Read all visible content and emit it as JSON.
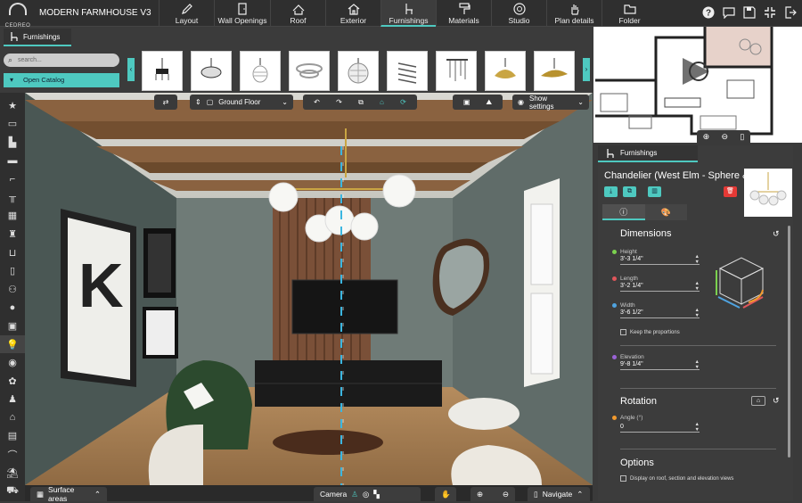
{
  "app": {
    "logo_text": "CEDREO",
    "project_title": "MODERN FARMHOUSE V3"
  },
  "nav": {
    "tabs": [
      {
        "label": "Layout",
        "icon": "pencil-icon"
      },
      {
        "label": "Wall Openings",
        "icon": "door-icon"
      },
      {
        "label": "Roof",
        "icon": "roof-icon"
      },
      {
        "label": "Exterior",
        "icon": "house-icon"
      },
      {
        "label": "Furnishings",
        "icon": "chair-icon",
        "active": true
      },
      {
        "label": "Materials",
        "icon": "paint-roller-icon"
      },
      {
        "label": "Studio",
        "icon": "aperture-icon"
      },
      {
        "label": "Plan details",
        "icon": "hand-icon"
      },
      {
        "label": "Folder",
        "icon": "folder-icon"
      }
    ]
  },
  "top_actions": [
    "help-icon",
    "comment-icon",
    "save-icon",
    "fullscreen-icon",
    "logout-icon"
  ],
  "catalog": {
    "tab_label": "Furnishings",
    "search_placeholder": "search...",
    "open_catalog": "Open Catalog",
    "thumbnail_count": 9
  },
  "viewport": {
    "floor": "Ground Floor",
    "show_settings": "Show settings",
    "bottom": {
      "surface_areas": "Surface areas",
      "camera": "Camera",
      "navigate": "Navigate"
    }
  },
  "properties": {
    "tab_label": "Furnishings",
    "item_name": "Chandelier (West Elm - Sphere &...",
    "dimensions_title": "Dimensions",
    "height_label": "Height",
    "height_value": "3'-3 1/4\"",
    "length_label": "Length",
    "length_value": "3'-2 1/4\"",
    "width_label": "Width",
    "width_value": "3'-6 1/2\"",
    "keep_proportions": "Keep the proportions",
    "elevation_label": "Elevation",
    "elevation_value": "9'-8 1/4\"",
    "rotation_title": "Rotation",
    "angle_label": "Angle (°)",
    "angle_value": "0",
    "options_title": "Options",
    "display_option": "Display on roof, section and elevation views"
  },
  "colors": {
    "accent": "#4ec9c0",
    "height_dot": "#7bd14f",
    "length_dot": "#e0565b",
    "width_dot": "#4fa3e0",
    "elevation_dot": "#9a63d6",
    "angle_dot": "#f29a2e",
    "delete": "#e53935"
  }
}
